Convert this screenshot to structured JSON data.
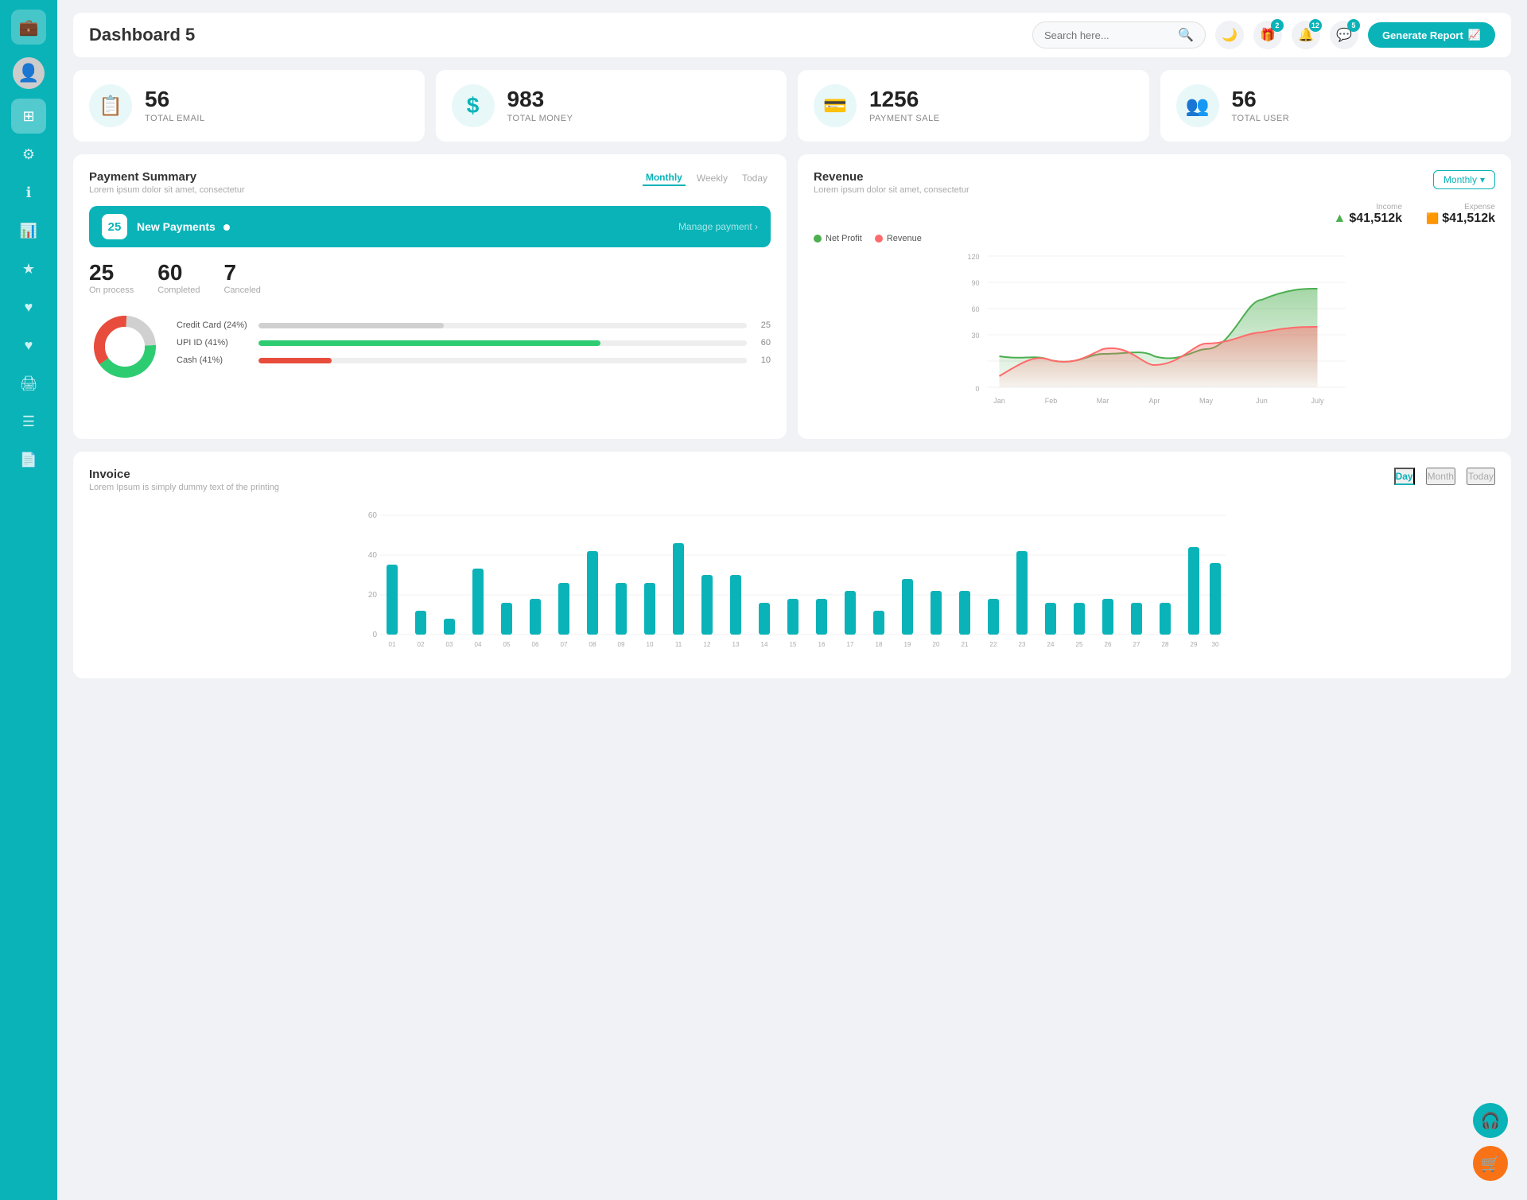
{
  "app": {
    "title": "Dashboard 5"
  },
  "header": {
    "search_placeholder": "Search here...",
    "generate_btn": "Generate Report",
    "badges": {
      "gift": "2",
      "bell": "12",
      "chat": "5"
    }
  },
  "stats": [
    {
      "id": "email",
      "number": "56",
      "label": "TOTAL EMAIL",
      "icon": "📋"
    },
    {
      "id": "money",
      "number": "983",
      "label": "TOTAL MONEY",
      "icon": "$"
    },
    {
      "id": "payment",
      "number": "1256",
      "label": "PAYMENT SALE",
      "icon": "💳"
    },
    {
      "id": "user",
      "number": "56",
      "label": "TOTAL USER",
      "icon": "👥"
    }
  ],
  "payment_summary": {
    "title": "Payment Summary",
    "subtitle": "Lorem ipsum dolor sit amet, consectetur",
    "tabs": [
      "Monthly",
      "Weekly",
      "Today"
    ],
    "active_tab": "Monthly",
    "new_payments": {
      "count": "25",
      "label": "New Payments",
      "manage_link": "Manage payment ›"
    },
    "stats": [
      {
        "num": "25",
        "label": "On process"
      },
      {
        "num": "60",
        "label": "Completed"
      },
      {
        "num": "7",
        "label": "Canceled"
      }
    ],
    "payment_methods": [
      {
        "label": "Credit Card (24%)",
        "value": 25,
        "color": "#ccc",
        "display": "25"
      },
      {
        "label": "UPI ID (41%)",
        "value": 60,
        "color": "#2ecc71",
        "display": "60"
      },
      {
        "label": "Cash (41%)",
        "value": 10,
        "color": "#e74c3c",
        "display": "10"
      }
    ],
    "donut": {
      "segments": [
        {
          "label": "Credit Card",
          "pct": 24,
          "color": "#d0d0d0"
        },
        {
          "label": "UPI ID",
          "pct": 41,
          "color": "#2ecc71"
        },
        {
          "label": "Cash",
          "pct": 35,
          "color": "#e74c3c"
        }
      ]
    }
  },
  "revenue": {
    "title": "Revenue",
    "subtitle": "Lorem ipsum dolor sit amet, consectetur",
    "dropdown": "Monthly",
    "income": {
      "label": "Income",
      "value": "$41,512k"
    },
    "expense": {
      "label": "Expense",
      "value": "$41,512k"
    },
    "legend": [
      {
        "label": "Net Profit",
        "color": "#4caf50"
      },
      {
        "label": "Revenue",
        "color": "#ff6b6b"
      }
    ],
    "chart": {
      "months": [
        "Jan",
        "Feb",
        "Mar",
        "Apr",
        "May",
        "Jun",
        "July"
      ],
      "net_profit": [
        28,
        25,
        30,
        28,
        35,
        80,
        90
      ],
      "revenue": [
        10,
        25,
        35,
        22,
        40,
        50,
        55
      ]
    }
  },
  "invoice": {
    "title": "Invoice",
    "subtitle": "Lorem Ipsum is simply dummy text of the printing",
    "tabs": [
      "Day",
      "Month",
      "Today"
    ],
    "active_tab": "Day",
    "chart": {
      "labels": [
        "01",
        "02",
        "03",
        "04",
        "05",
        "06",
        "07",
        "08",
        "09",
        "10",
        "11",
        "12",
        "13",
        "14",
        "15",
        "16",
        "17",
        "18",
        "19",
        "20",
        "21",
        "22",
        "23",
        "24",
        "25",
        "26",
        "27",
        "28",
        "29",
        "30"
      ],
      "values": [
        35,
        12,
        8,
        33,
        16,
        18,
        26,
        42,
        26,
        26,
        46,
        30,
        30,
        16,
        18,
        18,
        22,
        12,
        28,
        22,
        22,
        18,
        42,
        16,
        16,
        18,
        16,
        16,
        44,
        36
      ]
    }
  },
  "sidebar": {
    "items": [
      {
        "id": "wallet",
        "icon": "💼",
        "active": false
      },
      {
        "id": "dashboard",
        "icon": "⊞",
        "active": true
      },
      {
        "id": "settings",
        "icon": "⚙",
        "active": false
      },
      {
        "id": "info",
        "icon": "ℹ",
        "active": false
      },
      {
        "id": "chart",
        "icon": "📊",
        "active": false
      },
      {
        "id": "star",
        "icon": "★",
        "active": false
      },
      {
        "id": "heart",
        "icon": "♥",
        "active": false
      },
      {
        "id": "heart2",
        "icon": "♥",
        "active": false
      },
      {
        "id": "print",
        "icon": "🖨",
        "active": false
      },
      {
        "id": "list",
        "icon": "☰",
        "active": false
      },
      {
        "id": "report",
        "icon": "📄",
        "active": false
      }
    ]
  },
  "colors": {
    "primary": "#0ab3b8",
    "green": "#2ecc71",
    "red": "#e74c3c",
    "bar_bg": "#eeeeee"
  }
}
